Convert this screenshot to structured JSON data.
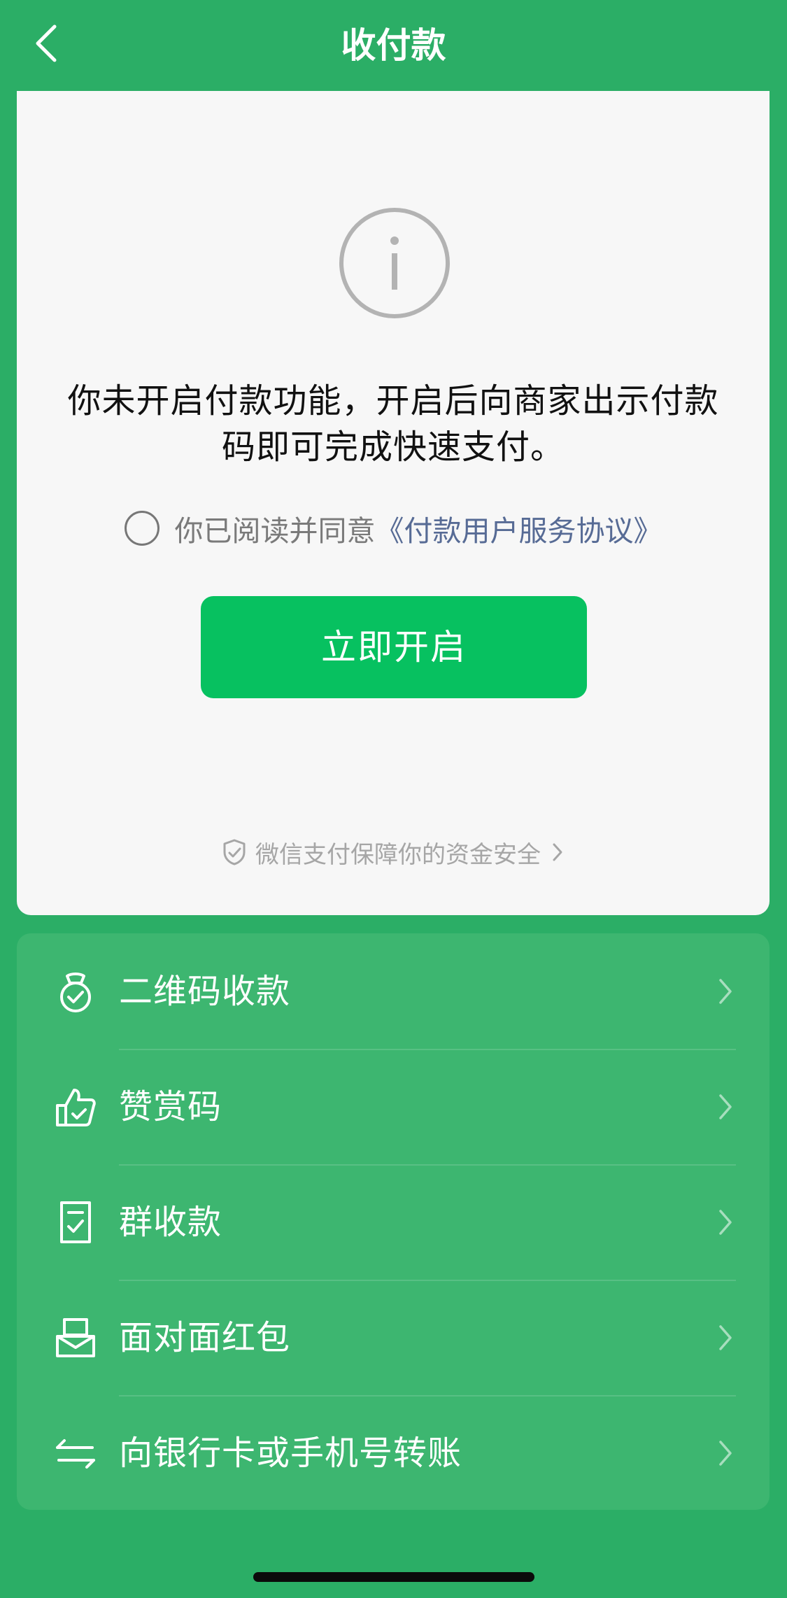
{
  "colors": {
    "background": "#2bae66",
    "card": "#f7f7f7",
    "primary_button": "#07c160",
    "link": "#576b95",
    "menu_panel": "#3db670"
  },
  "header": {
    "title": "收付款",
    "back_icon": "chevron-left-icon"
  },
  "card": {
    "icon": "info-icon",
    "message": "你未开启付款功能，开启后向商家出示付款码即可完成快速支付。",
    "agreement": {
      "checked": false,
      "prefix": "你已阅读并同意",
      "link_text": "《付款用户服务协议》"
    },
    "enable_button_label": "立即开启",
    "security_text": "微信支付保障你的资金安全"
  },
  "menu": {
    "items": [
      {
        "label": "二维码收款",
        "icon": "money-bag-icon"
      },
      {
        "label": "赞赏码",
        "icon": "thumbs-up-icon"
      },
      {
        "label": "群收款",
        "icon": "receipt-icon"
      },
      {
        "label": "面对面红包",
        "icon": "red-packet-icon"
      },
      {
        "label": "向银行卡或手机号转账",
        "icon": "transfer-icon"
      }
    ]
  }
}
